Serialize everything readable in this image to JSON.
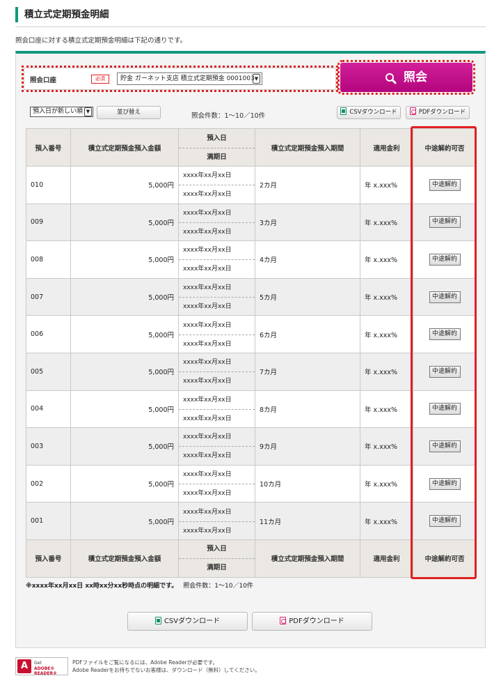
{
  "page": {
    "title": "積立式定期預金明細",
    "intro": "照会口座に対する積立式定期預金明細は下記の通りです。"
  },
  "search": {
    "account_label": "照会口座",
    "required_badge": "必須",
    "account_value": "貯金 ガーネット支店 積立式定期預金 0001003",
    "inquiry_button": "照会"
  },
  "controls": {
    "sort_value": "預入日が新しい順",
    "sort_button": "並び替え",
    "count_text": "照会件数：1〜10／10件",
    "csv_button": "CSVダウンロード",
    "pdf_button": "PDFダウンロード"
  },
  "table": {
    "headers": {
      "number": "預入番号",
      "amount": "積立式定期預金預入金額",
      "deposit_date": "預入日",
      "maturity_date": "満期日",
      "period": "積立式定期預金預入期間",
      "rate": "適用金利",
      "cancel": "中途解約可否"
    },
    "rows": [
      {
        "number": "010",
        "amount": "5,000円",
        "deposit_date": "xxxx年xx月xx日",
        "maturity_date": "xxxx年xx月xx日",
        "period": "2カ月",
        "rate": "年 x.xxx%",
        "action": "中途解約"
      },
      {
        "number": "009",
        "amount": "5,000円",
        "deposit_date": "xxxx年xx月xx日",
        "maturity_date": "xxxx年xx月xx日",
        "period": "3カ月",
        "rate": "年 x.xxx%",
        "action": "中途解約"
      },
      {
        "number": "008",
        "amount": "5,000円",
        "deposit_date": "xxxx年xx月xx日",
        "maturity_date": "xxxx年xx月xx日",
        "period": "4カ月",
        "rate": "年 x.xxx%",
        "action": "中途解約"
      },
      {
        "number": "007",
        "amount": "5,000円",
        "deposit_date": "xxxx年xx月xx日",
        "maturity_date": "xxxx年xx月xx日",
        "period": "5カ月",
        "rate": "年 x.xxx%",
        "action": "中途解約"
      },
      {
        "number": "006",
        "amount": "5,000円",
        "deposit_date": "xxxx年xx月xx日",
        "maturity_date": "xxxx年xx月xx日",
        "period": "6カ月",
        "rate": "年 x.xxx%",
        "action": "中途解約"
      },
      {
        "number": "005",
        "amount": "5,000円",
        "deposit_date": "xxxx年xx月xx日",
        "maturity_date": "xxxx年xx月xx日",
        "period": "7カ月",
        "rate": "年 x.xxx%",
        "action": "中途解約"
      },
      {
        "number": "004",
        "amount": "5,000円",
        "deposit_date": "xxxx年xx月xx日",
        "maturity_date": "xxxx年xx月xx日",
        "period": "8カ月",
        "rate": "年 x.xxx%",
        "action": "中途解約"
      },
      {
        "number": "003",
        "amount": "5,000円",
        "deposit_date": "xxxx年xx月xx日",
        "maturity_date": "xxxx年xx月xx日",
        "period": "9カ月",
        "rate": "年 x.xxx%",
        "action": "中途解約"
      },
      {
        "number": "002",
        "amount": "5,000円",
        "deposit_date": "xxxx年xx月xx日",
        "maturity_date": "xxxx年xx月xx日",
        "period": "10カ月",
        "rate": "年 x.xxx%",
        "action": "中途解約"
      },
      {
        "number": "001",
        "amount": "5,000円",
        "deposit_date": "xxxx年xx月xx日",
        "maturity_date": "xxxx年xx月xx日",
        "period": "11カ月",
        "rate": "年 x.xxx%",
        "action": "中途解約"
      }
    ]
  },
  "footnote": {
    "as_of": "※xxxx年xx月xx日 xx時xx分xx秒時点の明細です。",
    "count_text": "照会件数：1〜10／10件"
  },
  "downloads": {
    "csv_button": "CSVダウンロード",
    "pdf_button": "PDFダウンロード"
  },
  "adobe": {
    "badge_get": "Get",
    "badge_name": "ADOBE® READER®",
    "line1": "PDFファイルをご覧になるには、Adobe Readerが必要です。",
    "line2": "Adobe Readerをお持ちでないお客様は、ダウンロード（無料）してください。"
  },
  "colors": {
    "accent_green": "#11987d",
    "inquiry_magenta": "#c0108a",
    "highlight_red": "#e02020"
  }
}
